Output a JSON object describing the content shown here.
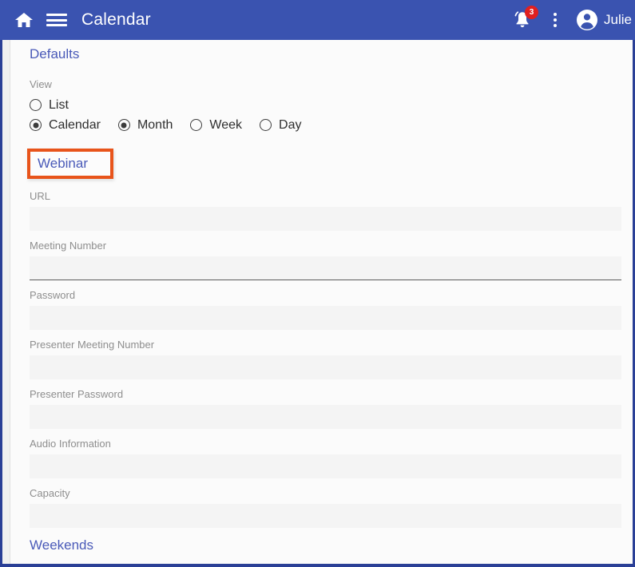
{
  "appbar": {
    "home_icon": "home-icon",
    "menu_icon": "hamburger-menu-icon",
    "title": "Calendar",
    "notification_icon": "bell-icon",
    "notification_count": "3",
    "overflow_icon": "kebab-menu-icon",
    "avatar_icon": "user-avatar-icon",
    "user_name": "Julie"
  },
  "sections": {
    "defaults_heading": "Defaults",
    "webinar_heading": "Webinar",
    "weekends_heading": "Weekends"
  },
  "view": {
    "label": "View",
    "rows": [
      [
        {
          "label": "List",
          "selected": false
        }
      ],
      [
        {
          "label": "Calendar",
          "selected": true
        },
        {
          "label": "Month",
          "selected": true
        },
        {
          "label": "Week",
          "selected": false
        },
        {
          "label": "Day",
          "selected": false
        }
      ]
    ],
    "row1": {
      "list_label": "List"
    },
    "row2": {
      "calendar_label": "Calendar",
      "month_label": "Month",
      "week_label": "Week",
      "day_label": "Day"
    }
  },
  "webinar_form": {
    "url": {
      "label": "URL",
      "value": "",
      "placeholder": ""
    },
    "meeting_number": {
      "label": "Meeting Number",
      "value": "",
      "placeholder": ""
    },
    "password": {
      "label": "Password",
      "value": "",
      "placeholder": ""
    },
    "presenter_meeting_number": {
      "label": "Presenter Meeting Number",
      "value": "",
      "placeholder": ""
    },
    "presenter_password": {
      "label": "Presenter Password",
      "value": "",
      "placeholder": ""
    },
    "audio_information": {
      "label": "Audio Information",
      "value": "",
      "placeholder": ""
    },
    "capacity": {
      "label": "Capacity",
      "value": "",
      "placeholder": ""
    }
  },
  "colors": {
    "appbar_blue": "#3a53b0",
    "frame_blue": "#2a3f96",
    "heading_blue": "#4a5ab8",
    "highlight_orange": "#e8541b",
    "badge_red": "#e02020",
    "field_gray": "#f4f4f4",
    "label_gray": "#8e8e8e"
  }
}
